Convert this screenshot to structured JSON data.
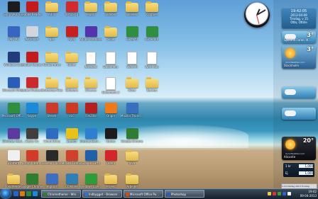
{
  "desktop_icons": [
    {
      "label": "Sony VAIO BD",
      "color": "#1c1c1c"
    },
    {
      "label": "VAIO AV",
      "color": "#3864c2"
    },
    {
      "label": "Windows Live",
      "color": "#233b7a"
    },
    {
      "label": "Microsoft Office Wor...",
      "color": "#2a5db8"
    },
    {
      "label": "Microsoft Office Excel",
      "color": "#2f8f3f"
    },
    {
      "label": "Windows Media...",
      "color": "#5c3aa0"
    },
    {
      "label": "UTorrent",
      "color": "#f0f0f0"
    },
    {
      "label": "dokumenter",
      "color": "#f2c84c"
    },
    {
      "label": "Adobe Reader",
      "color": "#c31b1b"
    },
    {
      "label": "Papirkurv",
      "color": "#d0d6dc"
    },
    {
      "label": "Adobe Reader",
      "color": "#c31b1b"
    },
    {
      "label": "Adobe Photoshop",
      "color": "#cc2a2a"
    },
    {
      "label": "Skype",
      "color": "#1b8ad8"
    },
    {
      "label": "Media Go",
      "color": "#3f3f3f"
    },
    {
      "label": "Norton Internet...",
      "color": "#d23a2a"
    },
    {
      "label": "Google Chrome",
      "color": "#2e7d32"
    },
    {
      "label": "Arkiv",
      "color": "#f2c84c"
    },
    {
      "label": "Net",
      "color": "#f2c84c"
    },
    {
      "label": "Konkurrence",
      "color": "#f2c84c"
    },
    {
      "label": "Photoshop Files",
      "color": "#f2c84c"
    },
    {
      "label": "Steam",
      "color": "#cc3a2a"
    },
    {
      "label": "Cloud Drive",
      "color": "#2d6cc0"
    },
    {
      "label": "Daemon Tools",
      "color": "#2a2a2a"
    },
    {
      "label": "ImgBurn",
      "color": "#3b6fc1"
    },
    {
      "label": "Virtual DJ",
      "color": "#d22b2b"
    },
    {
      "label": "Xbox",
      "color": "#c72020"
    },
    {
      "label": "Bilder",
      "color": "#f2c84c"
    },
    {
      "label": "Software",
      "color": "#f2c84c"
    },
    {
      "label": "VLC",
      "color": "#cc3a20"
    },
    {
      "label": "Spotify",
      "color": "#e8c21a"
    },
    {
      "label": "Mozilla Firefox",
      "color": "#d0402a"
    },
    {
      "label": "CCleaner",
      "color": "#2f7fb6"
    },
    {
      "label": "Musik",
      "color": "#f2c84c"
    },
    {
      "label": "Adobe Premiere",
      "color": "#5533aa"
    },
    {
      "label": "Notepad",
      "color": "#ffffff"
    },
    {
      "label": "Diverse",
      "color": "#f2c84c"
    },
    {
      "label": "FileZilla",
      "color": "#b51f1f"
    },
    {
      "label": "Internet Explorer",
      "color": "#2f7fd0"
    },
    {
      "label": "Google Earth",
      "color": "#2060a8"
    },
    {
      "label": "Windows Live Messenger",
      "color": "#2f9b3a"
    },
    {
      "label": "Videoer",
      "color": "#f2c84c"
    },
    {
      "label": "Skole",
      "color": "#f2c84c"
    },
    {
      "label": "Dokument",
      "color": "#ffffff"
    },
    {
      "label": "Dokument 2",
      "color": "#ffffff"
    },
    {
      "label": "Origin",
      "color": "#f07a1a"
    },
    {
      "label": "Itunes",
      "color": "#1c1c1c"
    },
    {
      "label": "Opera",
      "color": "#d2262a"
    },
    {
      "label": "Projekt",
      "color": "#f2c84c"
    },
    {
      "label": "Billeder",
      "color": "#f2c84c"
    },
    {
      "label": "Excel fil",
      "color": "#2f8f3f"
    },
    {
      "label": "Word fil",
      "color": "#ffffff"
    },
    {
      "label": "Noter",
      "color": "#f2c84c"
    },
    {
      "label": "Mozilla Thunderbird",
      "color": "#3a6fc0"
    },
    {
      "label": "Google Chrome",
      "color": "#2e7d32"
    },
    {
      "label": "Java",
      "color": "#f2c84c"
    },
    {
      "label": "Arbejde",
      "color": "#f2c84c"
    },
    {
      "label": "Opgave",
      "color": "#f2c84c"
    },
    {
      "label": "Excel ark",
      "color": "#2f8f3f"
    },
    {
      "label": "Word dok",
      "color": "#ffffff"
    },
    {
      "label": "Backup",
      "color": "#f2c84c"
    }
  ],
  "gadgets": {
    "clock": {
      "label": "analog clock"
    },
    "calendar": {
      "time": "19:42:05",
      "date": "2013-04-09",
      "weekday": "Tirsdag, v 15",
      "extra": "Otto, Ottilie"
    },
    "weather": [
      {
        "temp": "3°",
        "location": "Spøland Foren. N...",
        "style": "small"
      },
      {
        "temp": "3°",
        "location": "Stockholm",
        "style": "large",
        "link": "AccuWeather.com"
      },
      {
        "temp": "",
        "location": "",
        "style": "small"
      },
      {
        "temp": "",
        "location": "",
        "style": "small"
      },
      {
        "temp": "20°",
        "location": "Alicante",
        "style": "dark",
        "link": "AccuWeather.com"
      }
    ],
    "meter": {
      "row1_label": "1 kr",
      "row1_value": "1,000",
      "row2_label": "Ej",
      "row2_value": "1,000"
    },
    "status_text": "1:19 tirsdag 2013 Tirsdag"
  },
  "taskbar": {
    "tasks": [
      {
        "label": "Chrometheme - Win...",
        "color": "#2e7d32"
      },
      {
        "label": "Indbygget - Browser...",
        "color": "#3b6fc1"
      },
      {
        "label": "Microsoft Office Po...",
        "color": "#d04a1a"
      },
      {
        "label": "Photoshop",
        "color": "#2a5db8"
      }
    ],
    "quick_launch": [
      "#2a64c8",
      "#e07a10",
      "#2a8c3a",
      "#1b8ad8"
    ],
    "tray": {
      "time": "19:42",
      "date": "09-04-2013"
    },
    "tray_icons": [
      "#f2c84c",
      "#e03030",
      "#40a040",
      "#3060d0",
      "#ffffff"
    ]
  }
}
